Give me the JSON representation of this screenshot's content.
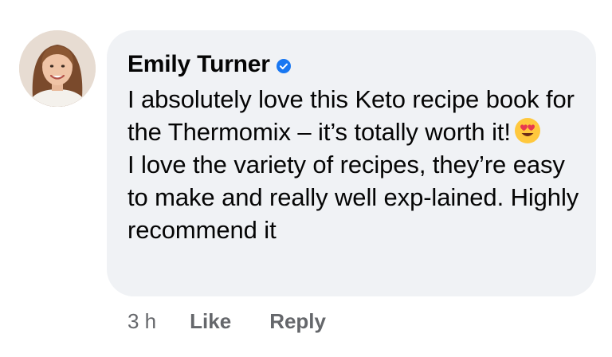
{
  "comment": {
    "author": "Emily Turner",
    "verified": true,
    "text_line1": "I absolutely love this Keto recipe book for the Thermomix – it’s totally worth it!",
    "emoji": "heart-eyes",
    "text_line2": "I love the variety of recipes, they’re easy to make and really well exp-lained. Highly recommend it"
  },
  "actions": {
    "timestamp": "3 h",
    "like_label": "Like",
    "reply_label": "Reply"
  },
  "colors": {
    "bubble_bg": "#f0f2f5",
    "verified_badge": "#1877f2",
    "meta_text": "#65676b"
  },
  "icons": {
    "avatar": "user-avatar",
    "verified": "verified-badge-icon",
    "emoji": "heart-eyes-emoji-icon"
  }
}
